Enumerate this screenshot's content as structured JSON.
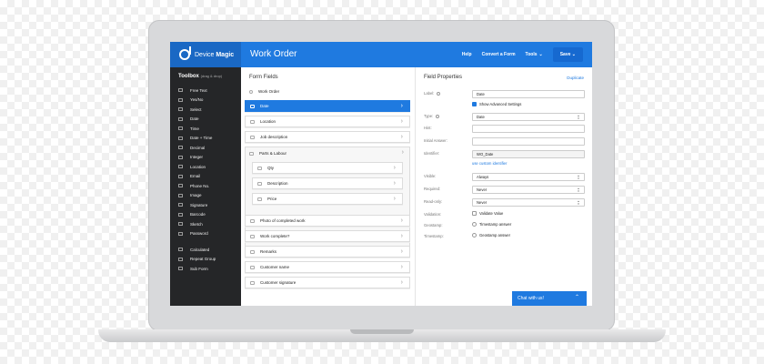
{
  "header": {
    "brand_light": "Device ",
    "brand_bold": "Magic",
    "title": "Work Order",
    "nav": {
      "help": "Help",
      "convert": "Convert a Form",
      "tools": "Tools",
      "save": "Save"
    }
  },
  "toolbox": {
    "title": "Toolbox",
    "hint": "(drag & drop)",
    "items": [
      "Free Text",
      "Yes/No",
      "Select",
      "Date",
      "Time",
      "Date + Time",
      "Decimal",
      "Integer",
      "Location",
      "Email",
      "Phone No.",
      "Image",
      "Signature",
      "Barcode",
      "Sketch",
      "Password"
    ],
    "extra_items": [
      "Calculated",
      "Repeat Group",
      "Sub Form"
    ]
  },
  "fields": {
    "title": "Form Fields",
    "top": "Work Order",
    "items": [
      "Date",
      "Location",
      "Job description",
      "Parts & Labour"
    ],
    "sub_items": [
      "Qty",
      "Description",
      "Price"
    ],
    "after": [
      "Photo of completed work",
      "Work complete?",
      "Remarks",
      "Customer name",
      "Customer signature"
    ]
  },
  "properties": {
    "title": "Field Properties",
    "duplicate": "Duplicate",
    "label_label": "Label:",
    "label_value": "Date",
    "show_advanced": "Show Advanced Settings",
    "type_label": "Type:",
    "type_value": "Date",
    "hint_label": "Hint:",
    "initial_label": "Initial Answer:",
    "identifier_label": "Identifier:",
    "identifier_value": "WO_Date",
    "custom_identifier": "use custom identifier",
    "visible_label": "Visible:",
    "visible_value": "Always",
    "required_label": "Required:",
    "required_value": "Never",
    "readonly_label": "Read-only:",
    "readonly_value": "Never",
    "validation_label": "Validation:",
    "validation_value": "Validate Value",
    "geostamp_label": "Geostamp:",
    "geostamp_value": "Timestamp answer",
    "timestamp_label": "Timestamp:",
    "timestamp_value": "Geostamp answer"
  },
  "chat": {
    "label": "Chat with us!"
  },
  "colors": {
    "accent": "#1f7ae0",
    "sidebar": "#252628"
  }
}
